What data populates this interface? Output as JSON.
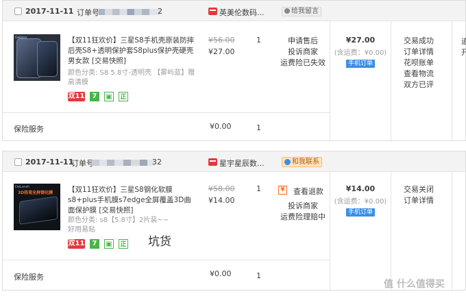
{
  "orders": [
    {
      "date": "2017-11-11",
      "order_no_label": "订单号:",
      "order_no_tail": "2",
      "seller": "英美伦数码...",
      "message_button": "给我留言",
      "product": {
        "title": "【双11狂欢价】三星S8手机壳原装防摔后壳S8+透明保护套S8plus保护壳硬壳男女款 [交易快照]",
        "spec": "颜色分类:  S8 5.8寸-透明壳  【雾屿蓝】赠高清膜",
        "tags": [
          "双11",
          "7"
        ],
        "original_price": "¥56.00",
        "price": "¥27.00",
        "qty": "1"
      },
      "after_sale": [
        "申请售后",
        "投诉商家",
        "运费险已失效"
      ],
      "total": "¥27.00",
      "shipping_note": "(含运费：¥0.00)",
      "badge": "手机订单",
      "status_links": [
        "交易成功",
        "订单详情",
        "花呗账单",
        "查看物流",
        "双方已评"
      ],
      "edge_text": [
        "追",
        "开"
      ],
      "insurance": {
        "label": "保险服务",
        "price": "¥0.00",
        "qty": "1"
      }
    },
    {
      "date": "2017-11-11",
      "order_no_label": "订单号",
      "order_no_tail": "32",
      "seller": "星宇星辰数...",
      "contact_button": "和我联系",
      "product": {
        "title": "【双11狂欢价】三星S8钢化软膜s8+plus手机膜s7edge全屏覆盖3D曲面保护膜 [交易快照]",
        "spec": "颜色分类:  s8【5.8寸】2片装~~好用易贴",
        "tags": [
          "双11",
          "7"
        ],
        "original_price": "¥58.00",
        "price": "¥14.00",
        "qty": "1",
        "thumb_text": "3D热弯全屏钢化膜"
      },
      "refund_icon": "¥",
      "after_sale": [
        "查看退款",
        "投诉商家",
        "运费险理赔中"
      ],
      "total": "¥14.00",
      "shipping_note": "(含运费：¥0.00)",
      "badge": "手机订单",
      "status_links": [
        "交易关闭",
        "订单详情"
      ],
      "insurance": {
        "label": "保险服务",
        "price": "¥0.00",
        "qty": "1"
      }
    }
  ],
  "annotation": "坑货",
  "watermark": "值 什么值得买",
  "colors": {
    "red": "#e4393c",
    "green": "#49b449",
    "blue": "#3a8ee6",
    "orange": "#f46c17",
    "header_bg": "#f3f3f3"
  }
}
